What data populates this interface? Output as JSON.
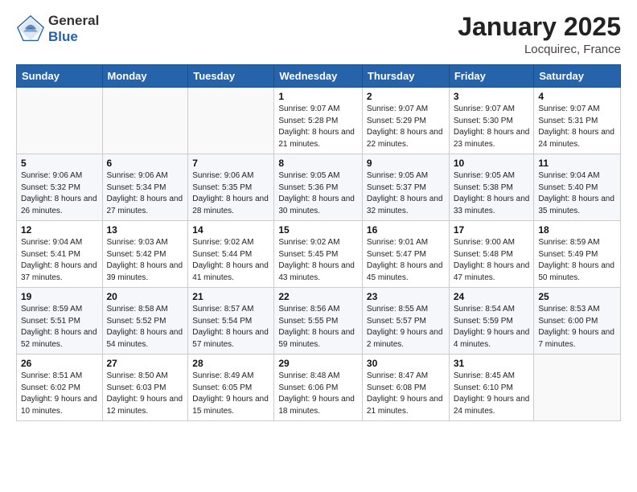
{
  "header": {
    "logo_general": "General",
    "logo_blue": "Blue",
    "month": "January 2025",
    "location": "Locquirec, France"
  },
  "days_of_week": [
    "Sunday",
    "Monday",
    "Tuesday",
    "Wednesday",
    "Thursday",
    "Friday",
    "Saturday"
  ],
  "weeks": [
    [
      {
        "day": "",
        "info": ""
      },
      {
        "day": "",
        "info": ""
      },
      {
        "day": "",
        "info": ""
      },
      {
        "day": "1",
        "info": "Sunrise: 9:07 AM\nSunset: 5:28 PM\nDaylight: 8 hours and 21 minutes."
      },
      {
        "day": "2",
        "info": "Sunrise: 9:07 AM\nSunset: 5:29 PM\nDaylight: 8 hours and 22 minutes."
      },
      {
        "day": "3",
        "info": "Sunrise: 9:07 AM\nSunset: 5:30 PM\nDaylight: 8 hours and 23 minutes."
      },
      {
        "day": "4",
        "info": "Sunrise: 9:07 AM\nSunset: 5:31 PM\nDaylight: 8 hours and 24 minutes."
      }
    ],
    [
      {
        "day": "5",
        "info": "Sunrise: 9:06 AM\nSunset: 5:32 PM\nDaylight: 8 hours and 26 minutes."
      },
      {
        "day": "6",
        "info": "Sunrise: 9:06 AM\nSunset: 5:34 PM\nDaylight: 8 hours and 27 minutes."
      },
      {
        "day": "7",
        "info": "Sunrise: 9:06 AM\nSunset: 5:35 PM\nDaylight: 8 hours and 28 minutes."
      },
      {
        "day": "8",
        "info": "Sunrise: 9:05 AM\nSunset: 5:36 PM\nDaylight: 8 hours and 30 minutes."
      },
      {
        "day": "9",
        "info": "Sunrise: 9:05 AM\nSunset: 5:37 PM\nDaylight: 8 hours and 32 minutes."
      },
      {
        "day": "10",
        "info": "Sunrise: 9:05 AM\nSunset: 5:38 PM\nDaylight: 8 hours and 33 minutes."
      },
      {
        "day": "11",
        "info": "Sunrise: 9:04 AM\nSunset: 5:40 PM\nDaylight: 8 hours and 35 minutes."
      }
    ],
    [
      {
        "day": "12",
        "info": "Sunrise: 9:04 AM\nSunset: 5:41 PM\nDaylight: 8 hours and 37 minutes."
      },
      {
        "day": "13",
        "info": "Sunrise: 9:03 AM\nSunset: 5:42 PM\nDaylight: 8 hours and 39 minutes."
      },
      {
        "day": "14",
        "info": "Sunrise: 9:02 AM\nSunset: 5:44 PM\nDaylight: 8 hours and 41 minutes."
      },
      {
        "day": "15",
        "info": "Sunrise: 9:02 AM\nSunset: 5:45 PM\nDaylight: 8 hours and 43 minutes."
      },
      {
        "day": "16",
        "info": "Sunrise: 9:01 AM\nSunset: 5:47 PM\nDaylight: 8 hours and 45 minutes."
      },
      {
        "day": "17",
        "info": "Sunrise: 9:00 AM\nSunset: 5:48 PM\nDaylight: 8 hours and 47 minutes."
      },
      {
        "day": "18",
        "info": "Sunrise: 8:59 AM\nSunset: 5:49 PM\nDaylight: 8 hours and 50 minutes."
      }
    ],
    [
      {
        "day": "19",
        "info": "Sunrise: 8:59 AM\nSunset: 5:51 PM\nDaylight: 8 hours and 52 minutes."
      },
      {
        "day": "20",
        "info": "Sunrise: 8:58 AM\nSunset: 5:52 PM\nDaylight: 8 hours and 54 minutes."
      },
      {
        "day": "21",
        "info": "Sunrise: 8:57 AM\nSunset: 5:54 PM\nDaylight: 8 hours and 57 minutes."
      },
      {
        "day": "22",
        "info": "Sunrise: 8:56 AM\nSunset: 5:55 PM\nDaylight: 8 hours and 59 minutes."
      },
      {
        "day": "23",
        "info": "Sunrise: 8:55 AM\nSunset: 5:57 PM\nDaylight: 9 hours and 2 minutes."
      },
      {
        "day": "24",
        "info": "Sunrise: 8:54 AM\nSunset: 5:59 PM\nDaylight: 9 hours and 4 minutes."
      },
      {
        "day": "25",
        "info": "Sunrise: 8:53 AM\nSunset: 6:00 PM\nDaylight: 9 hours and 7 minutes."
      }
    ],
    [
      {
        "day": "26",
        "info": "Sunrise: 8:51 AM\nSunset: 6:02 PM\nDaylight: 9 hours and 10 minutes."
      },
      {
        "day": "27",
        "info": "Sunrise: 8:50 AM\nSunset: 6:03 PM\nDaylight: 9 hours and 12 minutes."
      },
      {
        "day": "28",
        "info": "Sunrise: 8:49 AM\nSunset: 6:05 PM\nDaylight: 9 hours and 15 minutes."
      },
      {
        "day": "29",
        "info": "Sunrise: 8:48 AM\nSunset: 6:06 PM\nDaylight: 9 hours and 18 minutes."
      },
      {
        "day": "30",
        "info": "Sunrise: 8:47 AM\nSunset: 6:08 PM\nDaylight: 9 hours and 21 minutes."
      },
      {
        "day": "31",
        "info": "Sunrise: 8:45 AM\nSunset: 6:10 PM\nDaylight: 9 hours and 24 minutes."
      },
      {
        "day": "",
        "info": ""
      }
    ]
  ]
}
